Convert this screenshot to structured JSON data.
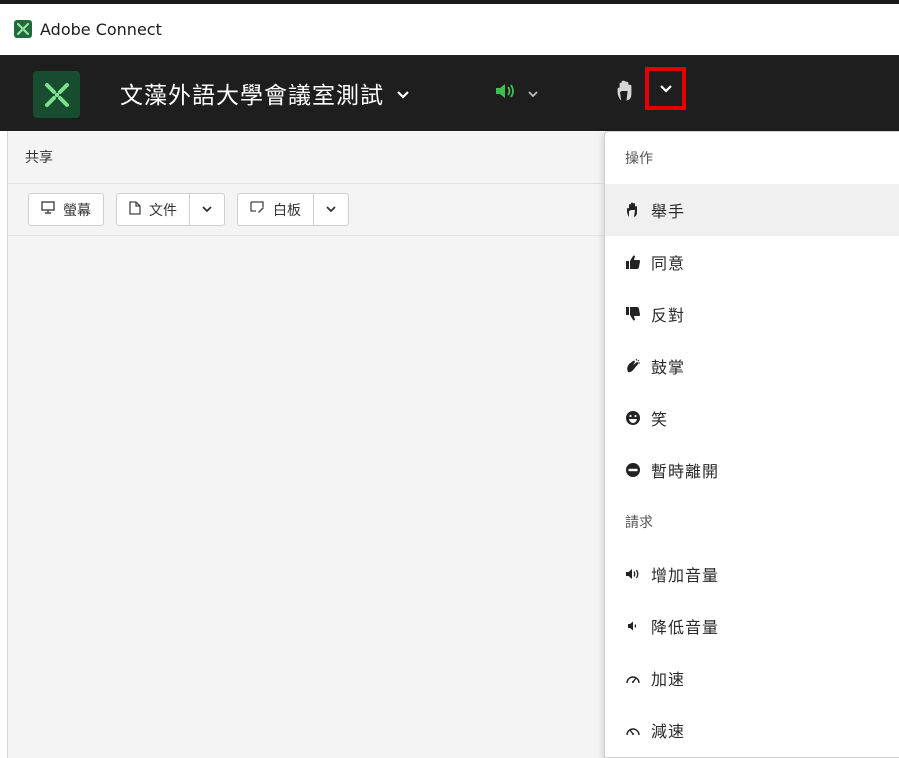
{
  "window": {
    "title": "Adobe Connect"
  },
  "header": {
    "room_title": "文藻外語大學會議室測試",
    "accent_color": "#3fbf4f",
    "highlight_color": "#e40000"
  },
  "share_pod": {
    "title": "共享",
    "buttons": {
      "screen": "螢幕",
      "document": "文件",
      "whiteboard": "白板"
    }
  },
  "menu": {
    "section_actions": "操作",
    "actions": [
      {
        "icon": "raise-hand-icon",
        "label": "舉手"
      },
      {
        "icon": "thumbs-up-icon",
        "label": "同意"
      },
      {
        "icon": "thumbs-down-icon",
        "label": "反對"
      },
      {
        "icon": "applause-icon",
        "label": "鼓掌"
      },
      {
        "icon": "laugh-icon",
        "label": "笑"
      },
      {
        "icon": "step-away-icon",
        "label": "暫時離開"
      }
    ],
    "section_requests": "請求",
    "requests": [
      {
        "icon": "volume-up-icon",
        "label": "增加音量"
      },
      {
        "icon": "volume-down-icon",
        "label": "降低音量"
      },
      {
        "icon": "speed-up-icon",
        "label": "加速"
      },
      {
        "icon": "slow-down-icon",
        "label": "減速"
      }
    ]
  }
}
